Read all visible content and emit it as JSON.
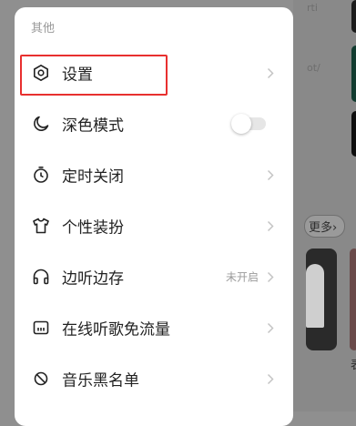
{
  "background": {
    "snippets": [
      "rti",
      "ot/"
    ],
    "more_label": "更多",
    "more_chevron_icon": "chevron-right-icon",
    "bottom_char": "表"
  },
  "drawer": {
    "section_title": "其他",
    "items": [
      {
        "label": "设置",
        "icon": "settings-hexagon-icon",
        "accessory": "chevron",
        "highlighted": true
      },
      {
        "label": "深色模式",
        "icon": "moon-icon",
        "accessory": "toggle",
        "toggle_on": false
      },
      {
        "label": "定时关闭",
        "icon": "timer-icon",
        "accessory": "chevron"
      },
      {
        "label": "个性装扮",
        "icon": "tshirt-icon",
        "accessory": "chevron"
      },
      {
        "label": "边听边存",
        "icon": "headphones-icon",
        "accessory": "chevron",
        "status": "未开启"
      },
      {
        "label": "在线听歌免流量",
        "icon": "sim-card-icon",
        "accessory": "chevron"
      },
      {
        "label": "音乐黑名单",
        "icon": "block-icon",
        "accessory": "chevron"
      }
    ]
  },
  "colors": {
    "highlight_border": "#e8302f",
    "text_primary": "#222222",
    "text_secondary": "#999999",
    "overlay": "#8f8f8f"
  }
}
